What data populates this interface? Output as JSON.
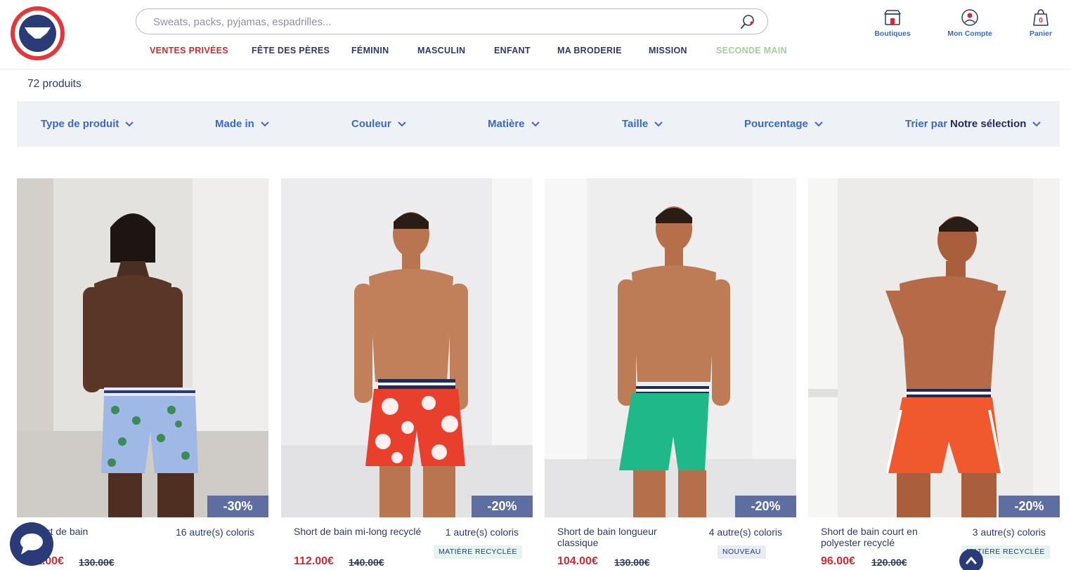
{
  "header": {
    "search_placeholder": "Sweats, packs, pyjamas, espadrilles...",
    "nav": [
      {
        "label": "VENTES PRIVÉES",
        "color": "#d8272e"
      },
      {
        "label": "FÊTE DES PÈRES",
        "color": "#2b3a67"
      },
      {
        "label": "FÉMININ",
        "color": "#2b3a67"
      },
      {
        "label": "MASCULIN",
        "color": "#2b3a67"
      },
      {
        "label": "ENFANT",
        "color": "#2b3a67"
      },
      {
        "label": "MA BRODERIE",
        "color": "#2b3a67"
      },
      {
        "label": "MISSION",
        "color": "#2b3a67"
      },
      {
        "label": "SECONDE MAIN",
        "color": "#9fd29a"
      }
    ],
    "actions": {
      "boutiques": "Boutiques",
      "account": "Mon Compte",
      "cart": "Panier",
      "cart_count": "0"
    }
  },
  "listing": {
    "count": "72 produits"
  },
  "filters": {
    "items": [
      "Type de produit",
      "Made in",
      "Couleur",
      "Matière",
      "Taille",
      "Pourcentage"
    ],
    "sort_label": "Trier par",
    "sort_value": "Notre sélection"
  },
  "products": [
    {
      "name": "Short de bain",
      "colors": "16 autre(s) coloris",
      "price": "91.00€",
      "old_price": "130.00€",
      "discount": "-30%",
      "tag": "",
      "swim_color": "#9fb8e6",
      "print": "stars"
    },
    {
      "name": "Short de bain mi-long recyclé",
      "colors": "1 autre(s) coloris",
      "price": "112.00€",
      "old_price": "140.00€",
      "discount": "-20%",
      "tag": "MATIÈRE RECYCLÉE",
      "swim_color": "#e8402c",
      "print": "hibiscus"
    },
    {
      "name": "Short de bain longueur classique",
      "colors": "4 autre(s) coloris",
      "price": "104.00€",
      "old_price": "130.00€",
      "discount": "-20%",
      "tag": "NOUVEAU",
      "swim_color": "#1fb888",
      "print": "plain"
    },
    {
      "name": "Short de bain court en polyester recyclé",
      "colors": "3 autre(s) coloris",
      "price": "96.00€",
      "old_price": "120.00€",
      "discount": "-20%",
      "tag": "MATIÈRE RECYCLÉE",
      "swim_color": "#f0592e",
      "print": "piping"
    }
  ]
}
